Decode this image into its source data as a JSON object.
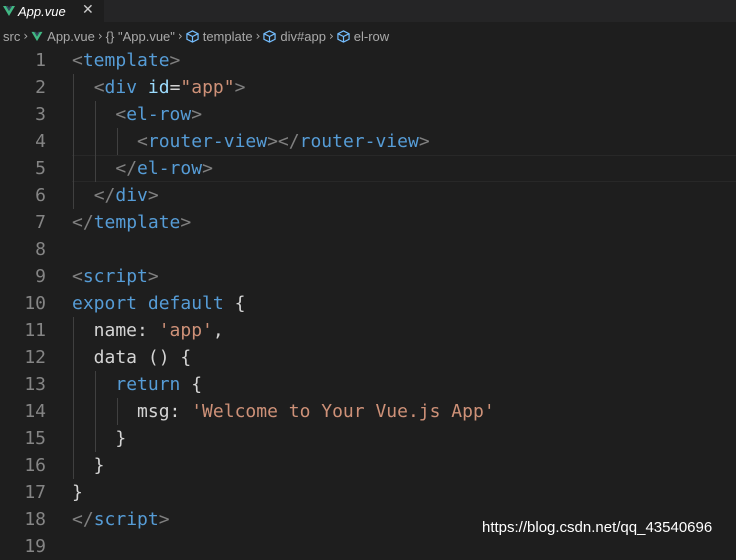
{
  "tab": {
    "label": "App.vue",
    "close": "✕"
  },
  "breadcrumb": {
    "items": [
      "src",
      "App.vue",
      "{} \"App.vue\"",
      "template",
      "div#app",
      "el-row"
    ]
  },
  "editor": {
    "line_numbers": [
      "1",
      "2",
      "3",
      "4",
      "5",
      "6",
      "7",
      "8",
      "9",
      "10",
      "11",
      "12",
      "13",
      "14",
      "15",
      "16",
      "17",
      "18",
      "19"
    ],
    "lines": [
      [
        [
          "punc",
          "<"
        ],
        [
          "tag",
          "template"
        ],
        [
          "punc",
          ">"
        ]
      ],
      [
        [
          "plain",
          "  "
        ],
        [
          "punc",
          "<"
        ],
        [
          "tag",
          "div"
        ],
        [
          "plain",
          " "
        ],
        [
          "attr",
          "id"
        ],
        [
          "plain",
          "="
        ],
        [
          "str",
          "\"app\""
        ],
        [
          "punc",
          ">"
        ]
      ],
      [
        [
          "plain",
          "    "
        ],
        [
          "punc",
          "<"
        ],
        [
          "tag",
          "el-row"
        ],
        [
          "punc",
          ">"
        ]
      ],
      [
        [
          "plain",
          "      "
        ],
        [
          "punc",
          "<"
        ],
        [
          "tag",
          "router-view"
        ],
        [
          "punc",
          "></"
        ],
        [
          "tag",
          "router-view"
        ],
        [
          "punc",
          ">"
        ]
      ],
      [
        [
          "plain",
          "    "
        ],
        [
          "punc",
          "</"
        ],
        [
          "tag",
          "el-row"
        ],
        [
          "punc",
          ">"
        ]
      ],
      [
        [
          "plain",
          "  "
        ],
        [
          "punc",
          "</"
        ],
        [
          "tag",
          "div"
        ],
        [
          "punc",
          ">"
        ]
      ],
      [
        [
          "punc",
          "</"
        ],
        [
          "tag",
          "template"
        ],
        [
          "punc",
          ">"
        ]
      ],
      [],
      [
        [
          "punc",
          "<"
        ],
        [
          "tag",
          "script"
        ],
        [
          "punc",
          ">"
        ]
      ],
      [
        [
          "kw",
          "export"
        ],
        [
          "plain",
          " "
        ],
        [
          "kw",
          "default"
        ],
        [
          "plain",
          " {"
        ]
      ],
      [
        [
          "plain",
          "  name: "
        ],
        [
          "str",
          "'app'"
        ],
        [
          "plain",
          ","
        ]
      ],
      [
        [
          "plain",
          "  data () {"
        ]
      ],
      [
        [
          "plain",
          "    "
        ],
        [
          "kw",
          "return"
        ],
        [
          "plain",
          " {"
        ]
      ],
      [
        [
          "plain",
          "      msg: "
        ],
        [
          "str",
          "'Welcome to Your Vue.js App'"
        ]
      ],
      [
        [
          "plain",
          "    }"
        ]
      ],
      [
        [
          "plain",
          "  }"
        ]
      ],
      [
        [
          "plain",
          "}"
        ]
      ],
      [
        [
          "punc",
          "</"
        ],
        [
          "tag",
          "script"
        ],
        [
          "punc",
          ">"
        ]
      ],
      []
    ]
  },
  "watermark": "https://blog.csdn.net/qq_43540696",
  "colors": {
    "background": "#1e1e1e",
    "tag": "#569cd6",
    "attribute": "#9cdcfe",
    "string": "#ce9178",
    "punctuation": "#808080",
    "line_number": "#858585",
    "vue_green": "#41b883"
  }
}
